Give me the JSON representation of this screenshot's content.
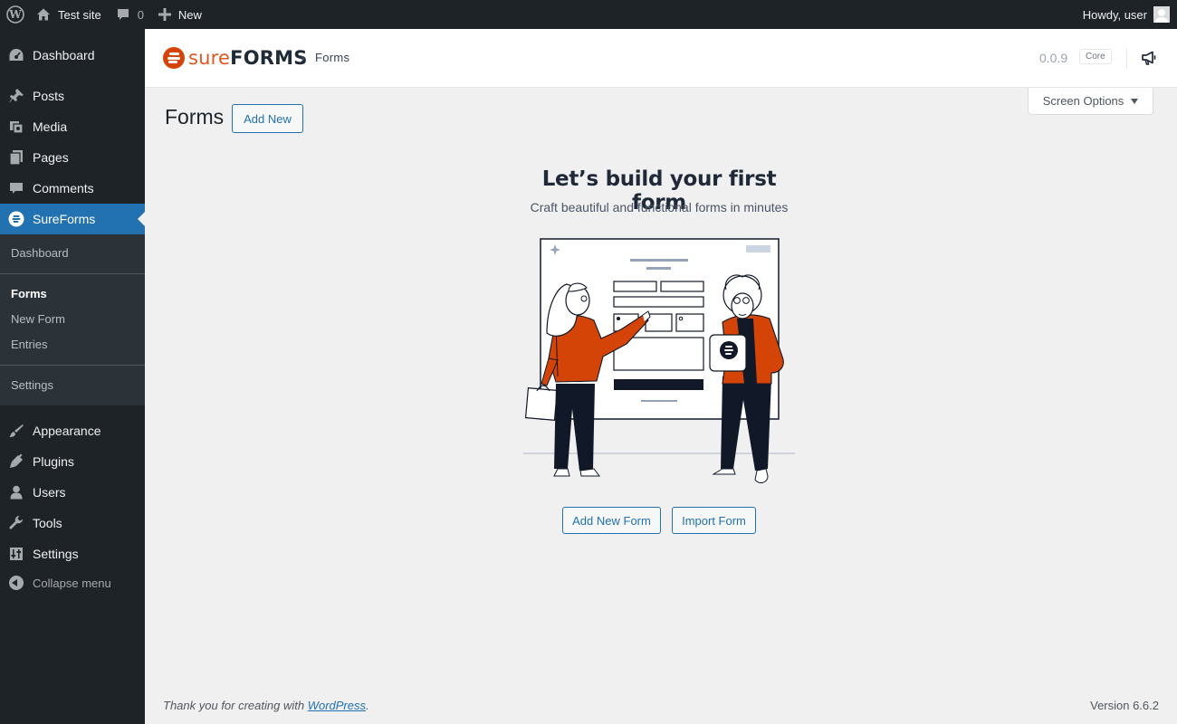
{
  "admin_bar": {
    "site_name": "Test site",
    "comments_count": "0",
    "new_label": "New",
    "greeting": "Howdy, user"
  },
  "sidebar": {
    "items": [
      {
        "label": "Dashboard",
        "icon": "dashboard-icon"
      },
      {
        "label": "Posts",
        "icon": "pin-icon"
      },
      {
        "label": "Media",
        "icon": "media-icon"
      },
      {
        "label": "Pages",
        "icon": "pages-icon"
      },
      {
        "label": "Comments",
        "icon": "comment-icon"
      },
      {
        "label": "SureForms",
        "icon": "sureforms-icon",
        "active": true
      },
      {
        "label": "Appearance",
        "icon": "brush-icon"
      },
      {
        "label": "Plugins",
        "icon": "plug-icon"
      },
      {
        "label": "Users",
        "icon": "user-icon"
      },
      {
        "label": "Tools",
        "icon": "wrench-icon"
      },
      {
        "label": "Settings",
        "icon": "settings-icon"
      }
    ],
    "submenu": [
      "Dashboard",
      "Forms",
      "New Form",
      "Entries",
      "Settings"
    ],
    "submenu_current": "Forms",
    "collapse_label": "Collapse menu"
  },
  "plugin_header": {
    "brand_prefix": "sure",
    "brand_suffix": "FORMS",
    "breadcrumb": "Forms",
    "version": "0.0.9",
    "badge": "Core"
  },
  "screen_options_label": "Screen Options",
  "page": {
    "title": "Forms",
    "add_new_label": "Add New"
  },
  "empty_state": {
    "title": "Let’s build your first form",
    "subtitle": "Craft beautiful and functional forms in minutes",
    "add_new_form_label": "Add New Form",
    "import_form_label": "Import Form"
  },
  "footer": {
    "thanks_prefix": "Thank you for creating with ",
    "wordpress_link": "WordPress",
    "thanks_suffix": ".",
    "version_text": "Version 6.6.2"
  },
  "colors": {
    "admin_dark": "#1d2327",
    "accent_blue": "#2271b1",
    "brand_orange": "#d54407"
  }
}
